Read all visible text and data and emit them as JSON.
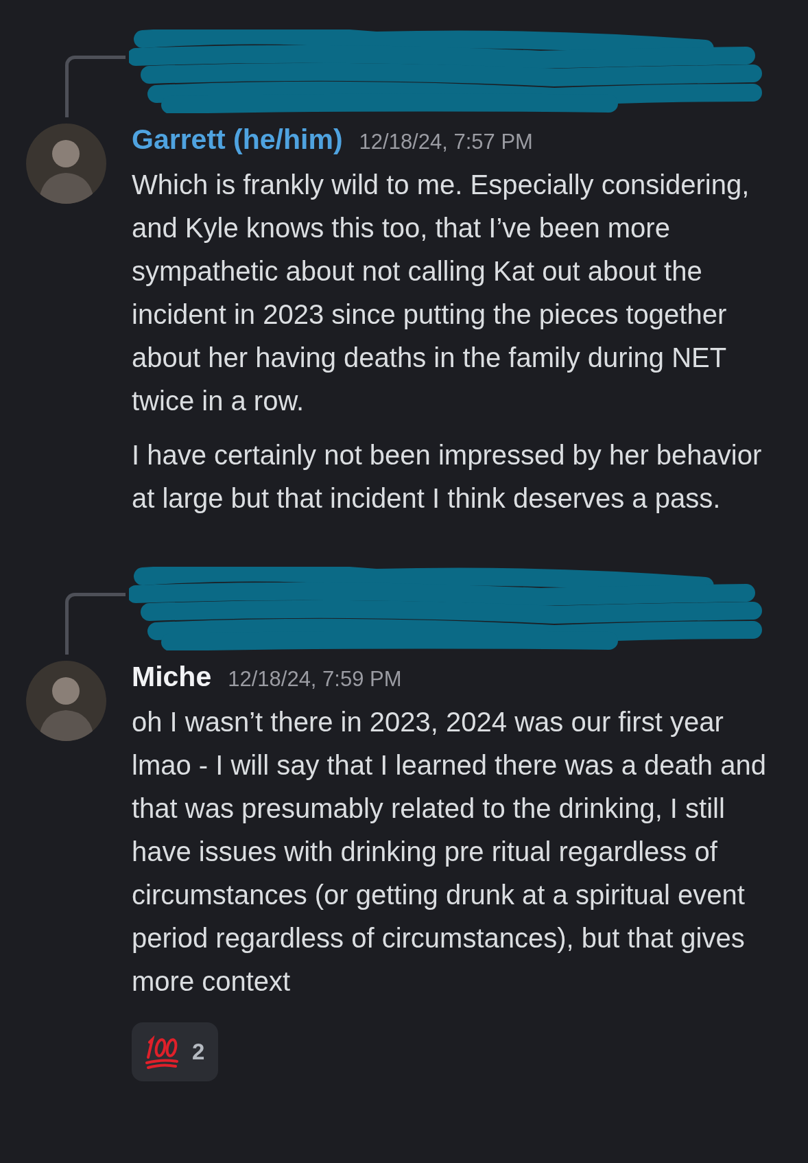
{
  "messages": [
    {
      "reply": {
        "redacted": true
      },
      "author": "Garrett (he/him)",
      "color": "#4fa3e0",
      "timestamp": "12/18/24, 7:57 PM",
      "paragraphs": [
        "Which is frankly wild to me. Especially considering, and Kyle knows this too, that I’ve been more sympathetic about not calling Kat out about the incident in 2023 since putting the pieces together about her having deaths in the family during NET twice in a row.",
        "I have certainly not been impressed by her behavior at large but that incident I think deserves a pass."
      ]
    },
    {
      "reply": {
        "redacted": true
      },
      "author": "Miche",
      "color": "#f2f3f5",
      "timestamp": "12/18/24, 7:59 PM",
      "paragraphs": [
        "oh I wasn’t there in 2023, 2024 was our first year lmao - I will say that I learned there was a death and that was presumably related to the drinking, I still have issues with drinking pre ritual regardless of circumstances (or getting drunk at a spiritual event period regardless of circumstances), but that gives more context"
      ],
      "reactions": [
        {
          "kind": "hundred",
          "count": "2"
        }
      ]
    }
  ]
}
